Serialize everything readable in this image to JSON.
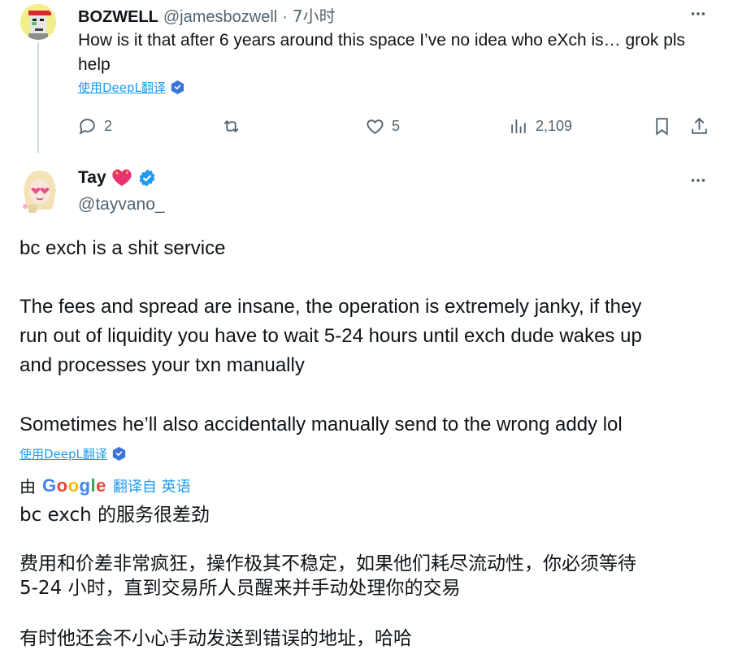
{
  "parent_tweet": {
    "author_name": "BOZWELL",
    "handle": "@jamesbozwell",
    "separator": "·",
    "time": "7小时",
    "text": "How is it that after 6 years around this space I’ve no idea who eXch is… grok pls help",
    "translate_link": "使用DeepL翻译",
    "replies": "2",
    "retweets": "",
    "likes": "5",
    "views": "2,109"
  },
  "main_tweet": {
    "author_name": "Tay",
    "handle": "@tayvano_",
    "paragraphs": [
      "bc exch is a shit service",
      "The fees and spread are insane, the operation is extremely janky, if they",
      "run out of liquidity you have to wait 5-24 hours until exch dude wakes up",
      "and processes your txn manually",
      "Sometimes he’ll also accidentally manually send to the wrong addy lol"
    ],
    "translate_link": "使用DeepL翻译",
    "translated_by_prefix": "由",
    "translated_by_brand": "Google",
    "translated_from": "翻译自 英语",
    "translation": [
      "bc exch 的服务很差劲",
      "费用和价差非常疯狂，操作极其不稳定，如果他们耗尽流动性，你必须等待",
      "5-24 小时，直到交易所人员醒来并手动处理你的交易",
      "有时他还会不小心手动发送到错误的地址，哈哈"
    ]
  },
  "colors": {
    "text_primary": "#0f1419",
    "text_secondary": "#536471",
    "link": "#1d9bf0",
    "verified": "#1d9bf0",
    "thread_line": "#cfd9de",
    "deepl_shield": "#3b73d6"
  },
  "icons": [
    "more-icon",
    "reply-icon",
    "retweet-icon",
    "like-icon",
    "views-icon",
    "bookmark-icon",
    "share-icon",
    "verified-icon",
    "heart-emoji-icon",
    "deepl-shield-icon"
  ]
}
